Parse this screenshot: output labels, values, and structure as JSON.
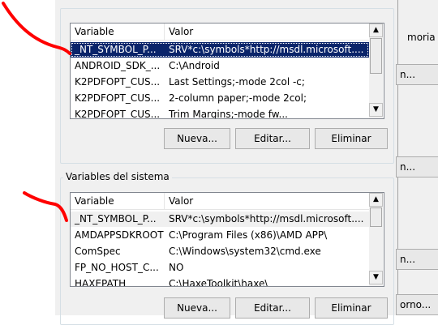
{
  "user_vars": {
    "columns": [
      "Variable",
      "Valor"
    ],
    "rows": [
      {
        "name": "_NT_SYMBOL_P...",
        "value": "SRV*c:\\symbols*http://msdl.microsoft....",
        "selected": true
      },
      {
        "name": "ANDROID_SDK_...",
        "value": "C:\\Android"
      },
      {
        "name": "K2PDFOPT_CUS...",
        "value": "Last Settings;-mode 2col -c;"
      },
      {
        "name": "K2PDFOPT_CUS...",
        "value": "2-column paper;-mode 2col;"
      },
      {
        "name": "K2PDFOPT_CUS...",
        "value": "Trim Margins;-mode fw..."
      }
    ],
    "buttons": {
      "new": "Nueva...",
      "edit": "Editar...",
      "delete": "Eliminar"
    }
  },
  "system_vars": {
    "title": "Variables del sistema",
    "columns": [
      "Variable",
      "Valor"
    ],
    "rows": [
      {
        "name": "_NT_SYMBOL_P...",
        "value": "SRV*c:\\symbols*http://msdl.microsoft....",
        "selected": true
      },
      {
        "name": "AMDAPPSDKROOT",
        "value": "C:\\Program Files (x86)\\AMD APP\\"
      },
      {
        "name": "ComSpec",
        "value": "C:\\Windows\\system32\\cmd.exe"
      },
      {
        "name": "FP_NO_HOST_C...",
        "value": "NO"
      },
      {
        "name": "HAXEPATH",
        "value": "C:\\HaxeToolkit\\haxe\\"
      }
    ],
    "buttons": {
      "new": "Nueva...",
      "edit": "Editar...",
      "delete": "Eliminar"
    }
  },
  "right_panel": {
    "label_top": "moria",
    "btn1": "n...",
    "btn2": "n...",
    "btn3": "n...",
    "btn4": "orno..."
  },
  "colors": {
    "selection": "#0a246a",
    "annotation": "#ff0000"
  }
}
